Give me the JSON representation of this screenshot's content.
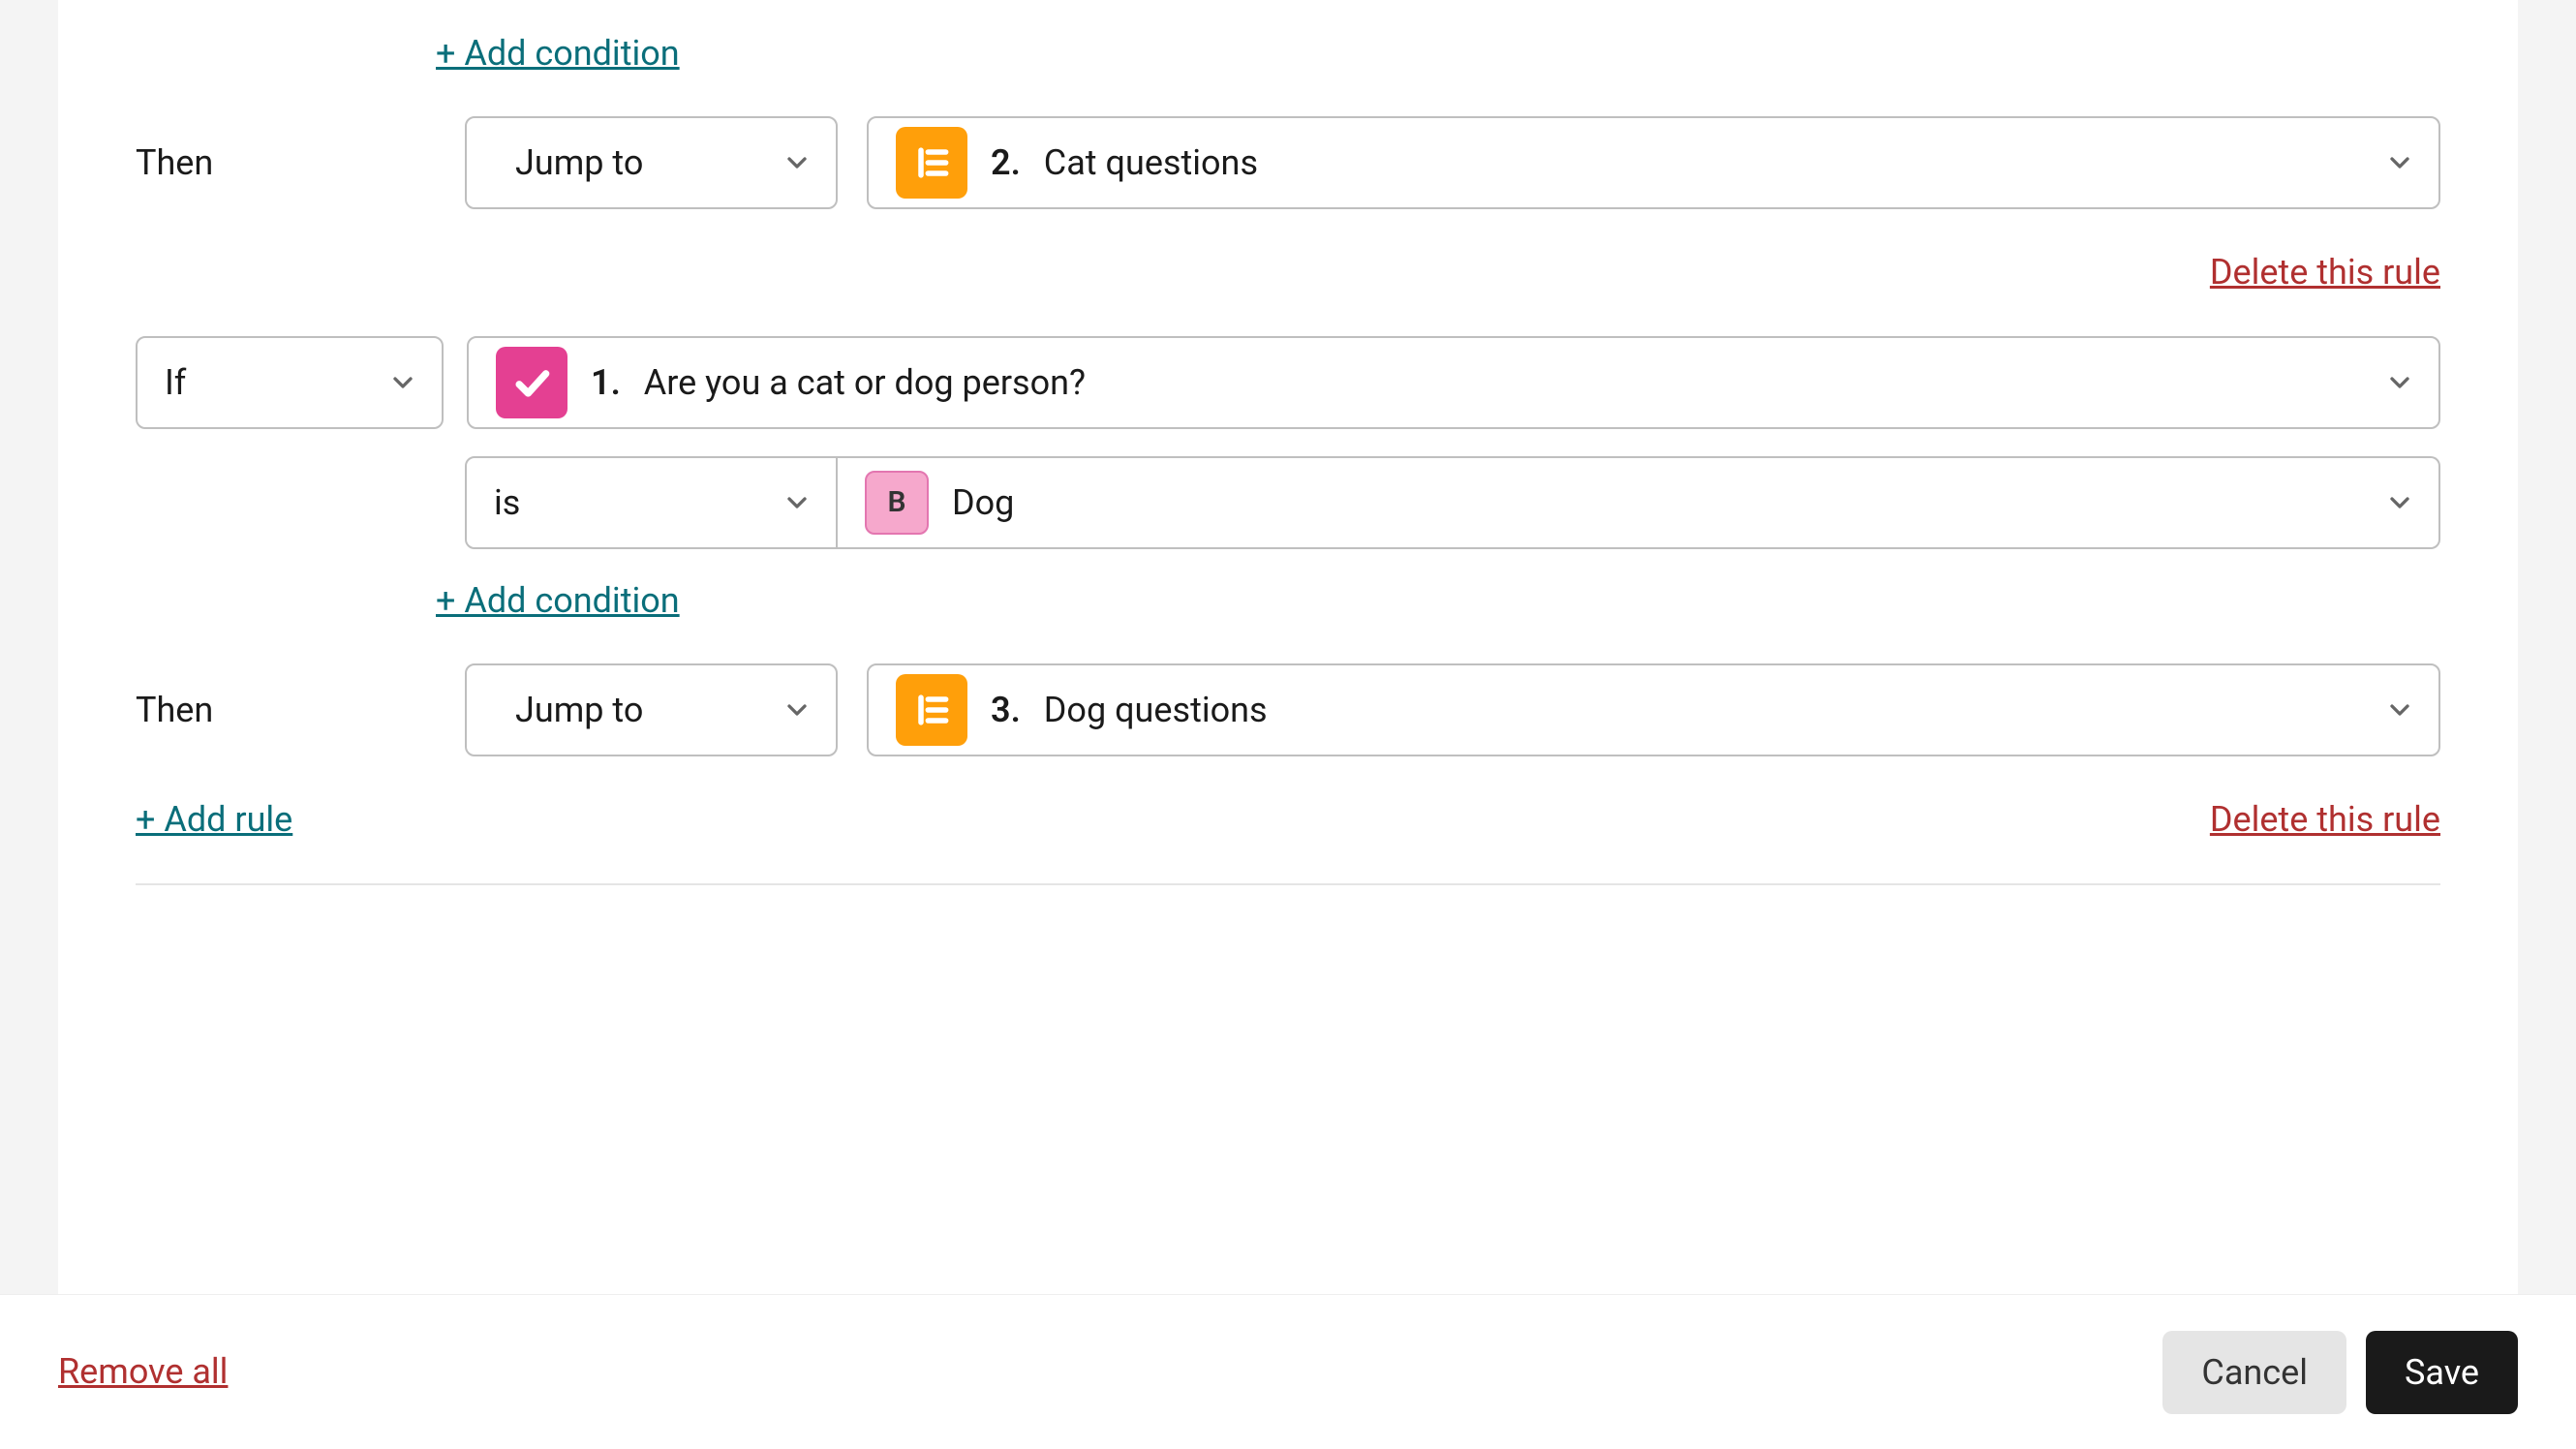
{
  "labels": {
    "then": "Then",
    "if": "If"
  },
  "actions": {
    "jump_to": "Jump to"
  },
  "operators": {
    "is": "is"
  },
  "links": {
    "add_condition": "+ Add condition",
    "delete_rule": "Delete this rule",
    "add_rule": "+ Add rule",
    "remove_all": "Remove all"
  },
  "buttons": {
    "cancel": "Cancel",
    "save": "Save"
  },
  "rule1": {
    "then": {
      "target_num": "2.",
      "target_label": "Cat questions"
    }
  },
  "rule2": {
    "if": {
      "conjunction": "If",
      "question_num": "1.",
      "question_label": "Are you a cat or dog person?",
      "answer_key": "B",
      "answer_label": "Dog"
    },
    "then": {
      "target_num": "3.",
      "target_label": "Dog questions"
    }
  }
}
